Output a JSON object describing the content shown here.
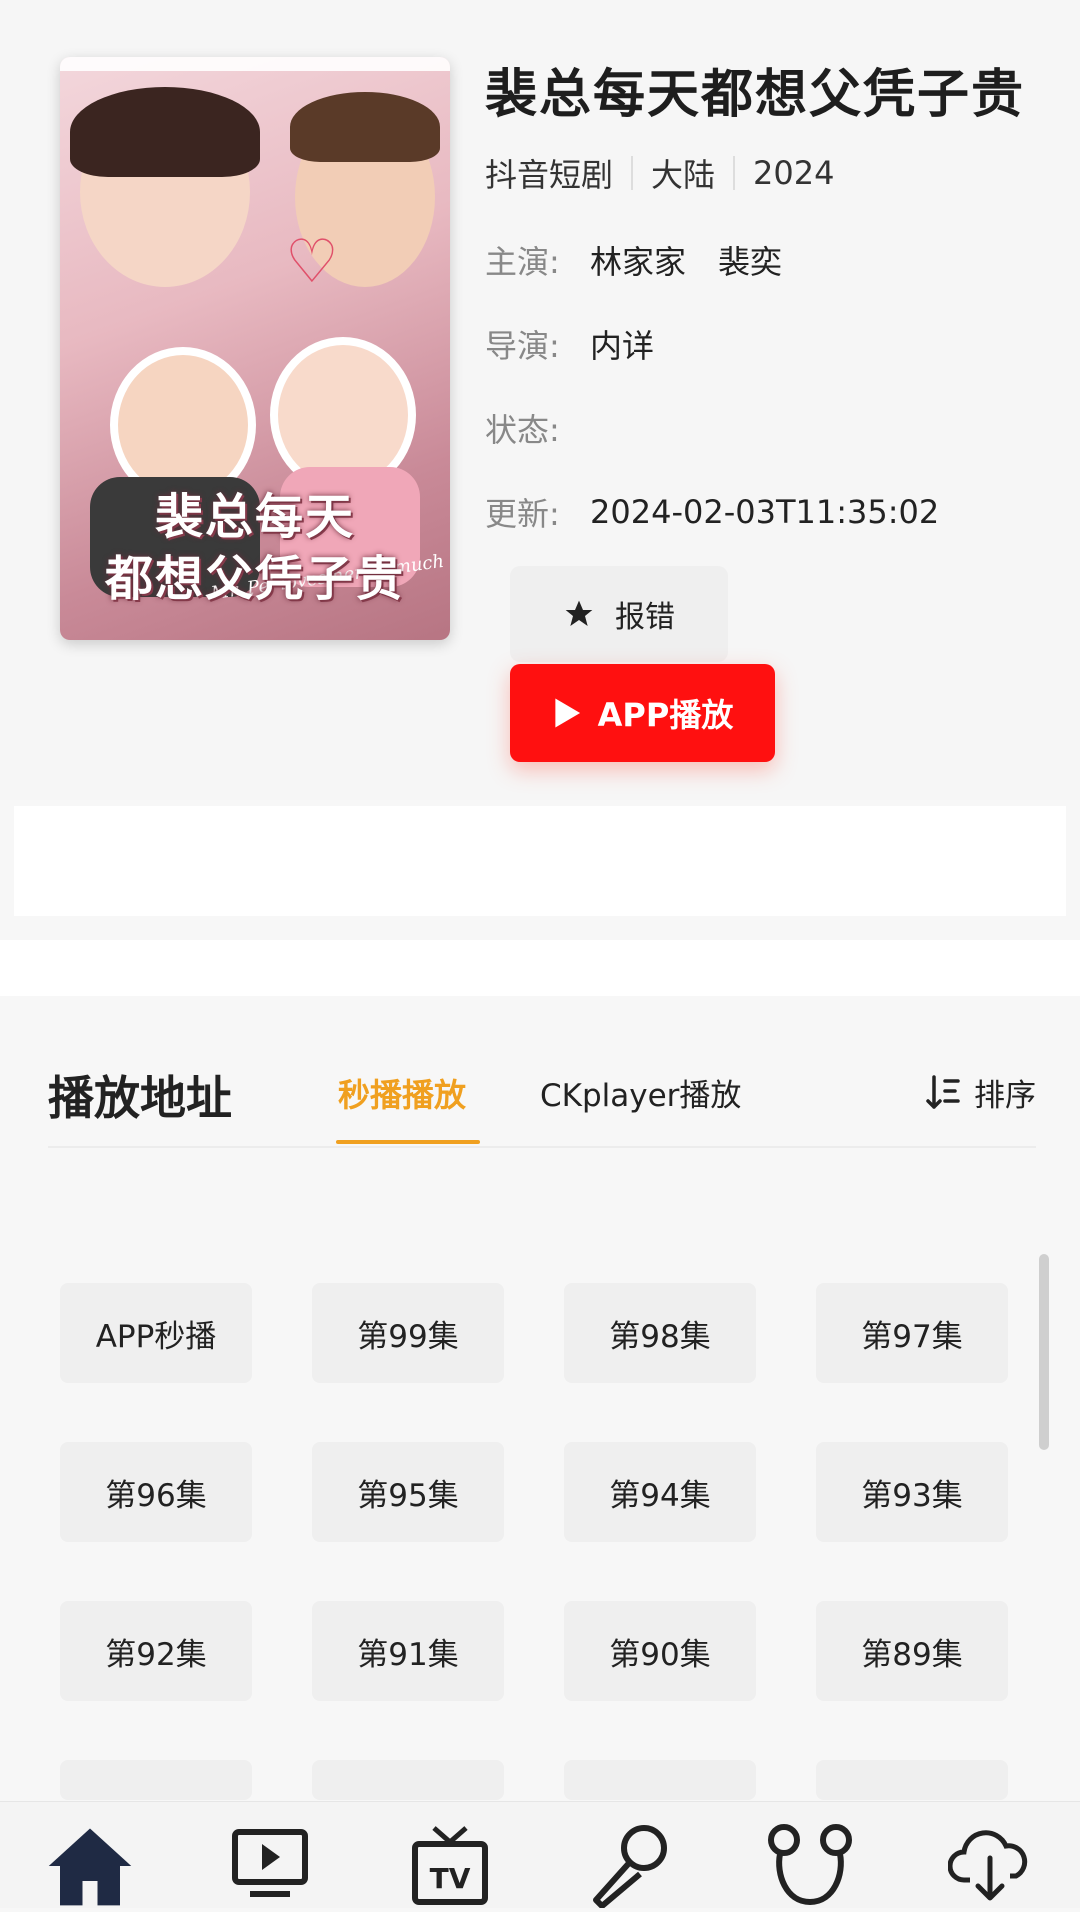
{
  "detail": {
    "title": "裴总每天都想父凭子贵",
    "type": "抖音短剧",
    "region": "大陆",
    "year": "2024",
    "cast_label": "主演:",
    "cast": "林家家　裴奕",
    "director_label": "导演:",
    "director": "内详",
    "status_label": "状态:",
    "status": "",
    "update_label": "更新:",
    "update": "2024-02-03T11:35:02",
    "report_button": "报错",
    "app_play_button": "APP播放"
  },
  "poster": {
    "title_line1": "裴总每天",
    "title_line2": "都想父凭子贵",
    "subtitle": "Mr. Pei loves her so much"
  },
  "playlist": {
    "heading": "播放地址",
    "tabs": [
      {
        "label": "秒播播放",
        "active": true
      },
      {
        "label": "CKplayer播放",
        "active": false
      }
    ],
    "sort_label": "排序",
    "episodes": [
      "APP秒播",
      "第99集",
      "第98集",
      "第97集",
      "第96集",
      "第95集",
      "第94集",
      "第93集",
      "第92集",
      "第91集",
      "第90集",
      "第89集"
    ]
  },
  "nav": {
    "items": [
      {
        "icon": "home-icon"
      },
      {
        "icon": "movie-icon"
      },
      {
        "icon": "tv-icon"
      },
      {
        "icon": "microphone-icon"
      },
      {
        "icon": "cartoon-icon"
      },
      {
        "icon": "download-icon"
      }
    ]
  },
  "colors": {
    "accent": "#f0a020",
    "play_button": "#ff1010"
  }
}
